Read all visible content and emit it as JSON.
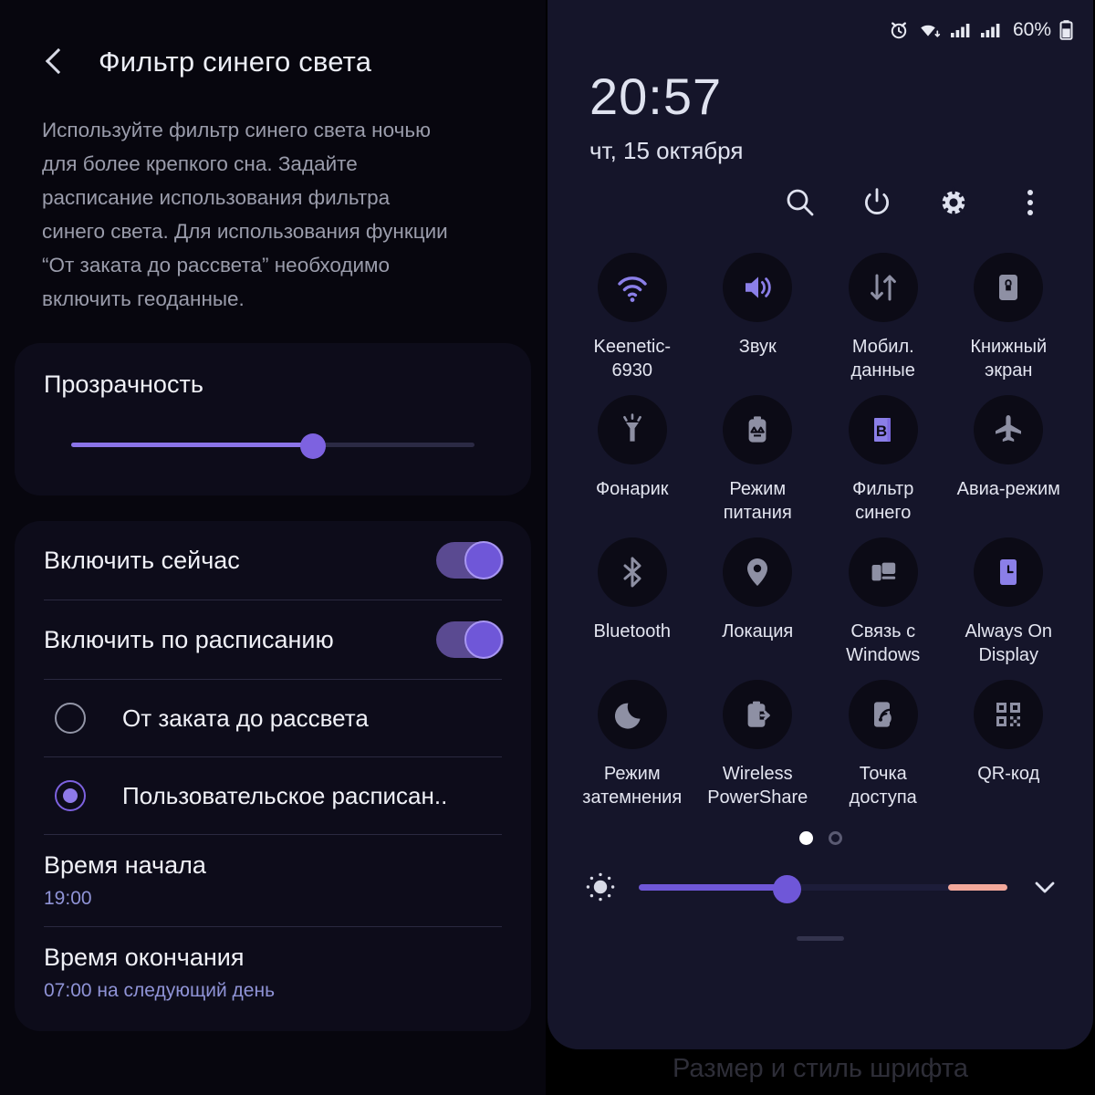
{
  "settings_panel": {
    "back_icon": "chevron-left-icon",
    "title": "Фильтр синего света",
    "description": "Используйте фильтр синего света ночью для более крепкого сна. Задайте расписание использования фильтра синего света. Для использования функции “От заката до рассвета” необходимо включить геоданные.",
    "opacity": {
      "title": "Прозрачность",
      "value_percent": 60
    },
    "toggles": [
      {
        "label": "Включить сейчас",
        "state": "on"
      },
      {
        "label": "Включить по расписанию",
        "state": "on"
      }
    ],
    "schedule_options": [
      {
        "label": "От заката до рассвета",
        "selected": false
      },
      {
        "label": "Пользовательское расписан..",
        "selected": true
      }
    ],
    "start_time": {
      "title": "Время начала",
      "value": "19:00"
    },
    "end_time": {
      "title": "Время окончания",
      "value": "07:00 на следующий день"
    }
  },
  "quick_panel": {
    "status_bar": {
      "icons": [
        "alarm-icon",
        "wifi-icon",
        "signal-bars-icon",
        "signal-bars-icon"
      ],
      "battery_percent": "60%",
      "battery_icon": "battery-icon"
    },
    "clock": {
      "time": "20:57",
      "date": "чт, 15 октября"
    },
    "actions": [
      {
        "name": "search-icon"
      },
      {
        "name": "power-icon"
      },
      {
        "name": "gear-icon"
      },
      {
        "name": "overflow-menu-icon"
      }
    ],
    "tiles": [
      {
        "label": "Keenetic-6930",
        "icon": "wifi-icon",
        "active": true
      },
      {
        "label": "Звук",
        "icon": "volume-icon",
        "active": true
      },
      {
        "label": "Мобил. данные",
        "icon": "data-transfer-icon",
        "active": false
      },
      {
        "label": "Книжный экран",
        "icon": "rotation-lock-icon",
        "active": false
      },
      {
        "label": "Фонарик",
        "icon": "flashlight-icon",
        "active": false
      },
      {
        "label": "Режим питания",
        "icon": "power-saving-icon",
        "active": false
      },
      {
        "label": "Фильтр синего",
        "icon": "blue-light-filter-icon",
        "active": true
      },
      {
        "label": "Авиа-режим",
        "icon": "airplane-icon",
        "active": false
      },
      {
        "label": "Bluetooth",
        "icon": "bluetooth-icon",
        "active": false
      },
      {
        "label": "Локация",
        "icon": "location-pin-icon",
        "active": false
      },
      {
        "label": "Связь с Windows",
        "icon": "link-to-windows-icon",
        "active": false
      },
      {
        "label": "Always On Display",
        "icon": "always-on-display-icon",
        "active": true
      },
      {
        "label": "Режим затемнения",
        "icon": "moon-icon",
        "active": false
      },
      {
        "label": "Wireless PowerShare",
        "icon": "wireless-powershare-icon",
        "active": false
      },
      {
        "label": "Точка доступа",
        "icon": "hotspot-icon",
        "active": false
      },
      {
        "label": "QR-код",
        "icon": "qr-code-icon",
        "active": false
      }
    ],
    "page_indicator": {
      "total": 2,
      "current": 1
    },
    "brightness": {
      "icon": "brightness-icon",
      "value_percent": 40,
      "expand_icon": "chevron-down-icon"
    },
    "background_text": "Размер и стиль шрифта"
  },
  "colors": {
    "accent_purple": "#7d62e0",
    "tile_active": "#8b7fe8",
    "tile_inactive": "#8e90a4",
    "warm_tint": "#f2a89b"
  }
}
